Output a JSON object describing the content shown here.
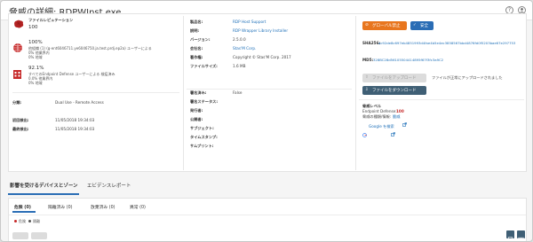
{
  "header": {
    "title": "脅威の詳細: RDPWInst.exe",
    "help_icon": "question-circle-icon",
    "user_icon": "user-icon"
  },
  "left": {
    "reputation": {
      "label": "ファイルレピュテーション",
      "value": "100"
    },
    "prevalence": {
      "percent": "100%",
      "line1": "他組織 (1) (g-ent6046711.ye6046750.ja.test.prdj.ep2a) ユーザーによる",
      "line2": "0% 他業界内",
      "line3": "0% 地域"
    },
    "detection": {
      "percent": "92.1%",
      "line1": "すべてのEndpoint Defense ユーザーによる 検疫済み",
      "line2": "0.0% 他業界内",
      "line3": "0% 地域"
    },
    "category_label": "分類:",
    "category_value": "Dual Use - Remote Access",
    "first_seen_label": "初回検出:",
    "first_seen_value": "11/05/2018 19:34:03",
    "last_seen_label": "最終検出:",
    "last_seen_value": "11/05/2018 19:34:03"
  },
  "middle": {
    "fields": [
      {
        "label": "製品名:",
        "value": "RDP Host Support",
        "link": true
      },
      {
        "label": "説明:",
        "value": "RDP Wrapper Library Installer",
        "link": true
      },
      {
        "label": "バージョン:",
        "value": "2.5.0.0",
        "link": false
      },
      {
        "label": "会社名:",
        "value": "Stas'M Corp.",
        "link": true
      },
      {
        "label": "著作権:",
        "value": "Copyright © Stas'M Corp. 2017",
        "link": false
      },
      {
        "label": "ファイルサイズ:",
        "value": "1.6 MB",
        "link": false
      }
    ],
    "sign_fields": [
      {
        "label": "署名済み:",
        "value": "False"
      },
      {
        "label": "署名ステータス:",
        "value": ""
      },
      {
        "label": "発行者:",
        "value": ""
      },
      {
        "label": "公開者:",
        "value": ""
      },
      {
        "label": "サブジェクト:",
        "value": ""
      },
      {
        "label": "タイムスタンプ:",
        "value": ""
      },
      {
        "label": "サムプリント:",
        "value": ""
      }
    ]
  },
  "right": {
    "global_ban_label": "グローバル禁止",
    "safe_label": "安全",
    "sha256_label": "SHA256:",
    "sha256_value": "ac92de8c697eb4851993d4fae4b5e4ec3858567bbd4876fd0f5203bae67e297753",
    "md5_label": "MD5:",
    "md5_value": "328BC28d56105504414895f67f3fc3a9C2",
    "upload_button_label": "ファイルをアップロード",
    "upload_note": "ファイルが正常にアップロードされました",
    "download_button_label": "ファイルをダウンロード",
    "threat_level_label": "脅威レベル",
    "threat_level_value_label": "Endpoint Defense:",
    "threat_level_value": "100",
    "threat_type_label": "脅威の種類/情報:",
    "threat_type_value": "脆威",
    "google_search_label": "Google を検索"
  },
  "tabs": {
    "items": [
      "影響を受けるデバイスとゾーン",
      "エビデンスレポート"
    ],
    "active": 0
  },
  "subtabs": {
    "items": [
      "危険 (0)",
      "隔離済み (0)",
      "放棄済み (0)",
      "異常 (0)"
    ],
    "active": 0,
    "legend_danger": "危険",
    "legend_quarantine": "隔離"
  },
  "colors": {
    "orange": "#e8761e",
    "blue": "#2a6db5",
    "red": "#c62828",
    "link": "#1d6fb8"
  }
}
